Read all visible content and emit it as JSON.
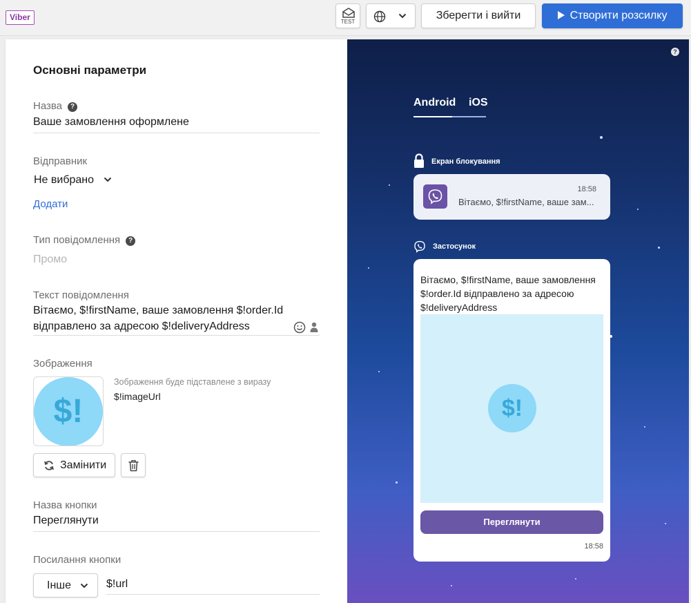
{
  "topbar": {
    "channel": "Viber",
    "test_label": "TEST",
    "save_exit": "Зберегти і вийти",
    "create_campaign": "Створити розсилку",
    "accent_color": "#2f6ed6"
  },
  "form": {
    "section_title": "Основні параметри",
    "name": {
      "label": "Назва",
      "value": "Ваше замовлення оформлене"
    },
    "sender": {
      "label": "Відправник",
      "value": "Не вибрано",
      "add_link": "Додати"
    },
    "message_type": {
      "label": "Тип повідомлення",
      "value": "Промо"
    },
    "message_text": {
      "label": "Текст повідомлення",
      "line1": "Вітаємо, $!firstName, ваше замовлення $!order.Id",
      "line2": "відправлено за адресою $!deliveryAddress"
    },
    "image": {
      "label": "Зображення",
      "placeholder_symbol": "$!",
      "hint": "Зображення буде підставлене з виразу",
      "expression": "$!imageUrl",
      "replace_label": "Замінити"
    },
    "button_name": {
      "label": "Назва кнопки",
      "value": "Переглянути"
    },
    "button_link": {
      "label": "Посилання кнопки",
      "type": "Інше",
      "value": "$!url"
    }
  },
  "preview": {
    "tabs": [
      "Android",
      "iOS"
    ],
    "lock_screen": {
      "title": "Екран блокування",
      "time": "18:58",
      "text": "Вітаємо, $!firstName, ваше зам..."
    },
    "app": {
      "title": "Застосунок",
      "message": "Вітаємо, $!firstName, ваше замовлення $!order.Id відправлено за адресою $!deliveryAddress",
      "image_symbol": "$!",
      "button": "Переглянути",
      "time": "18:58"
    },
    "viber_color": "#6a52a6"
  }
}
